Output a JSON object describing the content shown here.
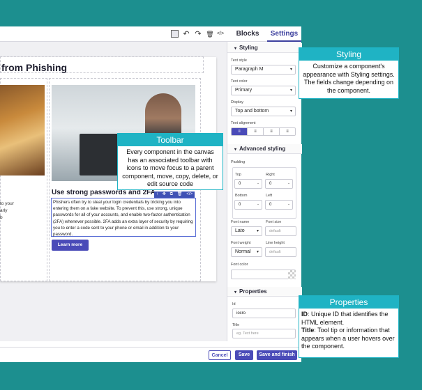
{
  "toolbar": {
    "icons": [
      "square-outline-icon",
      "undo-icon",
      "redo-icon",
      "trash-icon",
      "code-icon"
    ],
    "undo_glyph": "↶",
    "redo_glyph": "↷",
    "trash_glyph": "🗑",
    "code_glyph": "</>"
  },
  "tabs": [
    {
      "label": "Blocks",
      "active": false
    },
    {
      "label": "Settings",
      "active": true
    }
  ],
  "canvas": {
    "page_title": "from Phishing",
    "left_text": "to your\narly\nb",
    "card": {
      "heading": "Use strong passwords and 2FA",
      "body": "Phishers often try to steal your login credentials by tricking you into entering them on a fake website. To prevent this, use strong, unique passwords for all of your accounts, and enable two-factor authentication (2FA) whenever possible. 2FA adds an extra layer of security by requiring you to enter a code sent to your phone or email in addition to your password.",
      "button": "Learn more"
    },
    "mini_toolbar": [
      "↑",
      "✥",
      "⧉",
      "🗑",
      "</>"
    ]
  },
  "styling": {
    "section_title": "Styling",
    "text_style_label": "Text style",
    "text_style_value": "Paragraph M",
    "text_color_label": "Text color",
    "text_color_value": "Primary",
    "display_label": "Display",
    "display_value": "Top and bottom",
    "text_alignment_label": "Text alignment",
    "alignment_options": [
      "≡",
      "≡",
      "≡",
      "≡"
    ]
  },
  "advanced": {
    "section_title": "Advanced styling",
    "padding_label": "Padding",
    "top_label": "Top",
    "top_value": "0",
    "right_label": "Right",
    "right_value": "0",
    "bottom_label": "Bottom",
    "bottom_value": "0",
    "left_label": "Left",
    "left_value": "0",
    "font_name_label": "Font name",
    "font_name_value": "Lato",
    "font_size_label": "Font size",
    "font_size_placeholder": "default",
    "font_weight_label": "Font weight",
    "font_weight_value": "Normal",
    "line_height_label": "Line height",
    "line_height_placeholder": "default",
    "font_color_label": "Font color"
  },
  "properties": {
    "section_title": "Properties",
    "id_label": "Id",
    "id_value": "iocro",
    "title_label": "Title",
    "title_placeholder": "eg. Text here"
  },
  "footer": {
    "cancel": "Cancel",
    "save": "Save",
    "save_finish": "Save and finish"
  },
  "callouts": {
    "styling": {
      "title": "Styling",
      "body": "Customize a component's appearance with Styling settings. The fields change depending on the component."
    },
    "toolbar": {
      "title": "Toolbar",
      "body": "Every component in the canvas has an associated toolbar with icons to move focus to a parent component, move, copy, delete, or edit source code"
    },
    "properties": {
      "title": "Properties",
      "id_term": "ID",
      "id_desc": ": Unique ID that identifies the HTML element.",
      "title_term": "Title",
      "title_desc": ": Tool tip or information that appears when a user hovers over the component."
    }
  },
  "colors": {
    "background": "#1c8f8f",
    "accent": "#4a4bb8",
    "callout": "#1fb3c4",
    "selection": "#5b6fd6"
  }
}
